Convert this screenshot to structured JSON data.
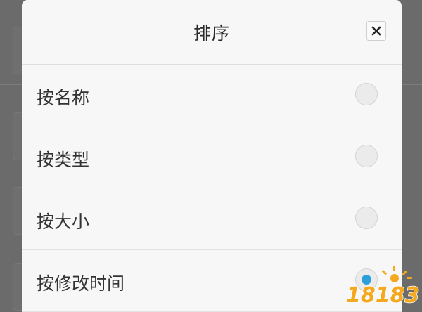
{
  "dialog": {
    "title": "排序",
    "close_icon": "close-icon",
    "options": [
      {
        "label": "按名称",
        "checked": false
      },
      {
        "label": "按类型",
        "checked": false
      },
      {
        "label": "按大小",
        "checked": false
      },
      {
        "label": "按修改时间",
        "checked": true
      }
    ]
  },
  "watermark": {
    "text": "18183"
  },
  "colors": {
    "accent": "#2c9fdb",
    "dialog_bg": "#f7f7f7",
    "overlay": "#6b6b6b",
    "watermark": "#f4a81d"
  }
}
